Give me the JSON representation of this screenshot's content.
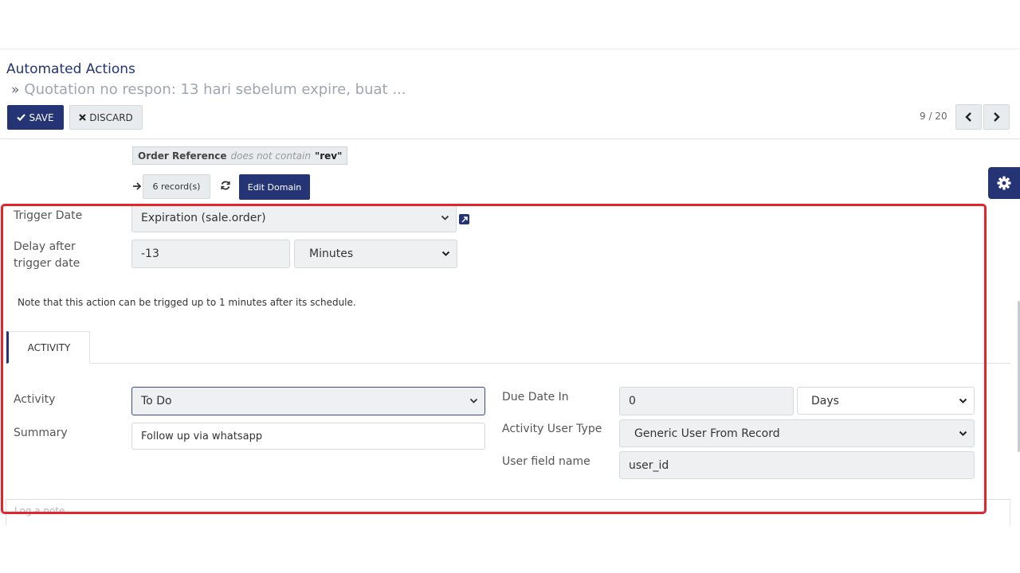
{
  "breadcrumb": {
    "root": "Automated Actions",
    "separator": "»",
    "current": "Quotation no respon: 13 hari sebelum expire, buat ..."
  },
  "buttons": {
    "save": "SAVE",
    "discard": "DISCARD",
    "edit_domain": "Edit Domain",
    "records": "6 record(s)"
  },
  "pager": {
    "value": "9 / 20"
  },
  "domain": {
    "field": "Order Reference",
    "operator": "does not contain",
    "value": "\"rev\""
  },
  "trigger": {
    "trigger_date_label": "Trigger Date",
    "trigger_date_value": "Expiration (sale.order)",
    "delay_label": "Delay after trigger date",
    "delay_value": "-13",
    "delay_unit": "Minutes",
    "note": "Note that this action can be trigged up to 1 minutes after its schedule."
  },
  "tabs": {
    "activity": "ACTIVITY"
  },
  "activity": {
    "activity_label": "Activity",
    "activity_value": "To Do",
    "summary_label": "Summary",
    "summary_value": "Follow up via whatsapp",
    "due_label": "Due Date In",
    "due_value": "0",
    "due_unit": "Days",
    "user_type_label": "Activity User Type",
    "user_type_value": "Generic User From Record",
    "user_field_label": "User field name",
    "user_field_value": "user_id"
  },
  "chatter": {
    "placeholder": "Log a note..."
  },
  "colors": {
    "primary": "#243474",
    "highlight": "#e3242b"
  }
}
